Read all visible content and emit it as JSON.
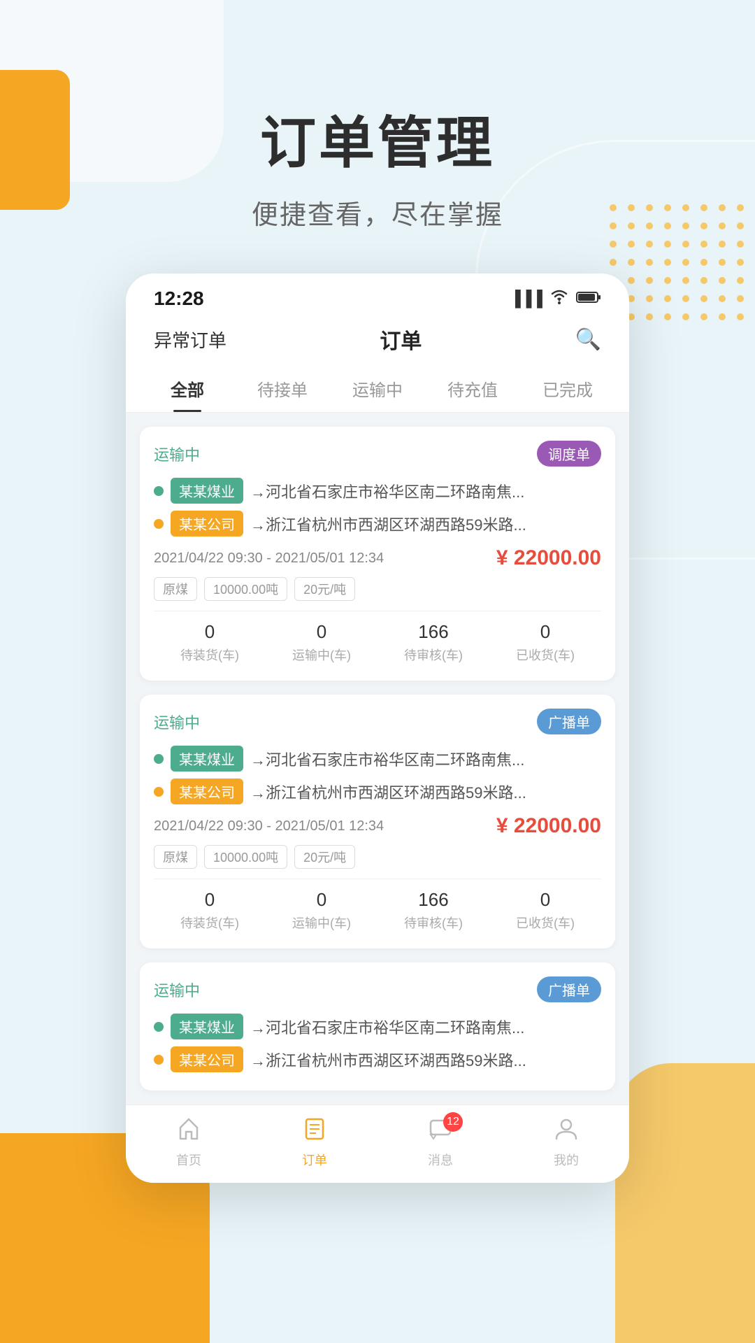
{
  "background": {
    "title": "订单管理",
    "subtitle": "便捷查看，尽在掌握"
  },
  "statusBar": {
    "time": "12:28"
  },
  "navBar": {
    "left": "异常订单",
    "center": "订单",
    "searchIcon": "🔍"
  },
  "tabs": [
    {
      "label": "全部",
      "active": true
    },
    {
      "label": "待接单",
      "active": false
    },
    {
      "label": "运输中",
      "active": false
    },
    {
      "label": "待充值",
      "active": false
    },
    {
      "label": "已完成",
      "active": false
    }
  ],
  "orders": [
    {
      "status": "运输中",
      "badge": "调度单",
      "badgeType": "purple",
      "routes": [
        {
          "dot": "green",
          "companyTag": "某某煤业",
          "tagColor": "green",
          "text": "→河北省石家庄市裕华区南二环路南焦..."
        },
        {
          "dot": "orange",
          "companyTag": "某某公司",
          "tagColor": "orange",
          "text": "→浙江省杭州市西湖区环湖西路59米路..."
        }
      ],
      "date": "2021/04/22 09:30 - 2021/05/01 12:34",
      "price": "¥ 22000.00",
      "infoTags": [
        "原煤",
        "10000.00吨",
        "20元/吨"
      ],
      "stats": [
        {
          "num": "0",
          "label": "待装货(车)"
        },
        {
          "num": "0",
          "label": "运输中(车)"
        },
        {
          "num": "166",
          "label": "待审核(车)"
        },
        {
          "num": "0",
          "label": "已收货(车)"
        }
      ]
    },
    {
      "status": "运输中",
      "badge": "广播单",
      "badgeType": "blue",
      "routes": [
        {
          "dot": "green",
          "companyTag": "某某煤业",
          "tagColor": "green",
          "text": "→河北省石家庄市裕华区南二环路南焦..."
        },
        {
          "dot": "orange",
          "companyTag": "某某公司",
          "tagColor": "orange",
          "text": "→浙江省杭州市西湖区环湖西路59米路..."
        }
      ],
      "date": "2021/04/22 09:30 - 2021/05/01 12:34",
      "price": "¥ 22000.00",
      "infoTags": [
        "原煤",
        "10000.00吨",
        "20元/吨"
      ],
      "stats": [
        {
          "num": "0",
          "label": "待装货(车)"
        },
        {
          "num": "0",
          "label": "运输中(车)"
        },
        {
          "num": "166",
          "label": "待审核(车)"
        },
        {
          "num": "0",
          "label": "已收货(车)"
        }
      ]
    },
    {
      "status": "运输中",
      "badge": "广播单",
      "badgeType": "blue",
      "routes": [
        {
          "dot": "green",
          "companyTag": "某某煤业",
          "tagColor": "green",
          "text": "→河北省石家庄市裕华区南二环路南焦..."
        }
      ],
      "date": "",
      "price": "",
      "infoTags": [],
      "stats": []
    }
  ],
  "bottomNav": [
    {
      "label": "首页",
      "icon": "🏠",
      "active": false
    },
    {
      "label": "订单",
      "icon": "📋",
      "active": true,
      "badge": null
    },
    {
      "label": "消息",
      "icon": "💬",
      "active": false,
      "badge": "12"
    },
    {
      "label": "我的",
      "icon": "👤",
      "active": false
    }
  ]
}
